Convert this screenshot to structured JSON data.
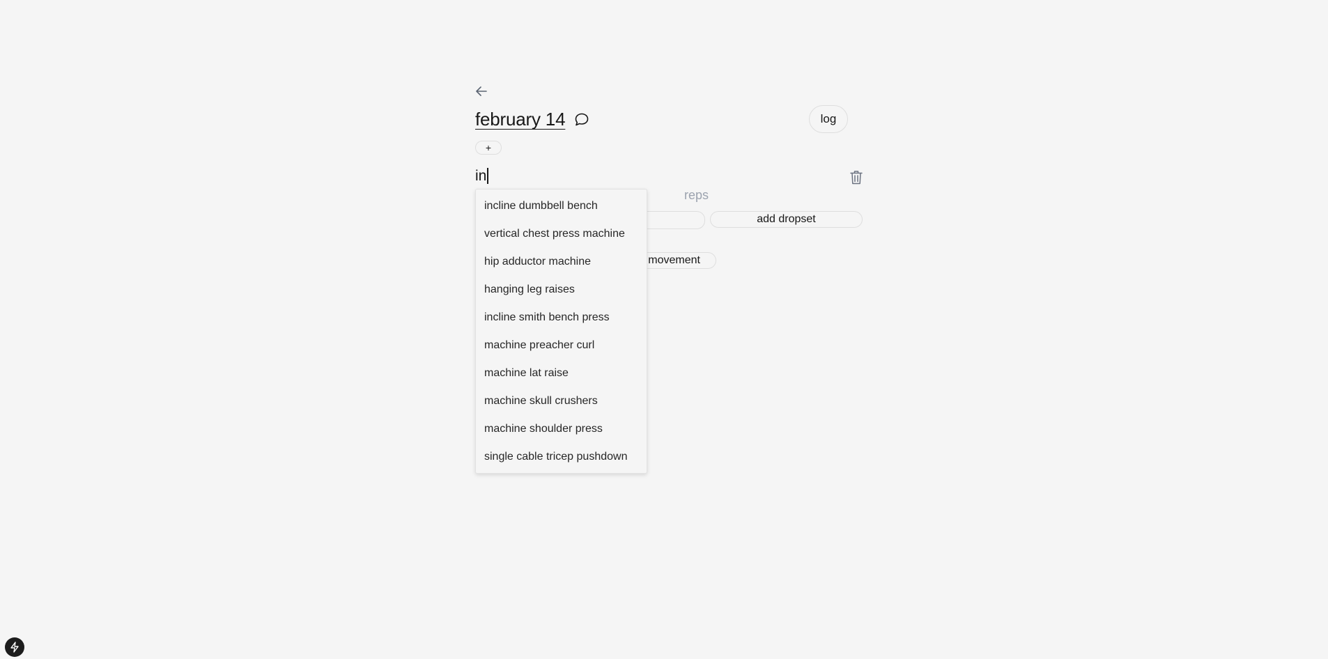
{
  "header": {
    "date_title": "february 14",
    "log_label": "log",
    "add_label": "+"
  },
  "exercise": {
    "input_value": "in",
    "reps_label": "reps",
    "add_dropset_label": "add dropset",
    "add_movement_label": "movement"
  },
  "suggestions": [
    "incline dumbbell bench",
    "vertical chest press machine",
    "hip adductor machine",
    "hanging leg raises",
    "incline smith bench press",
    "machine preacher curl",
    "machine lat raise",
    "machine skull crushers",
    "machine shoulder press",
    "single cable tricep pushdown"
  ],
  "icons": {
    "back": "arrow-left-icon",
    "comment": "message-circle-icon",
    "trash": "trash-icon",
    "bolt": "lightning-bolt-icon"
  }
}
